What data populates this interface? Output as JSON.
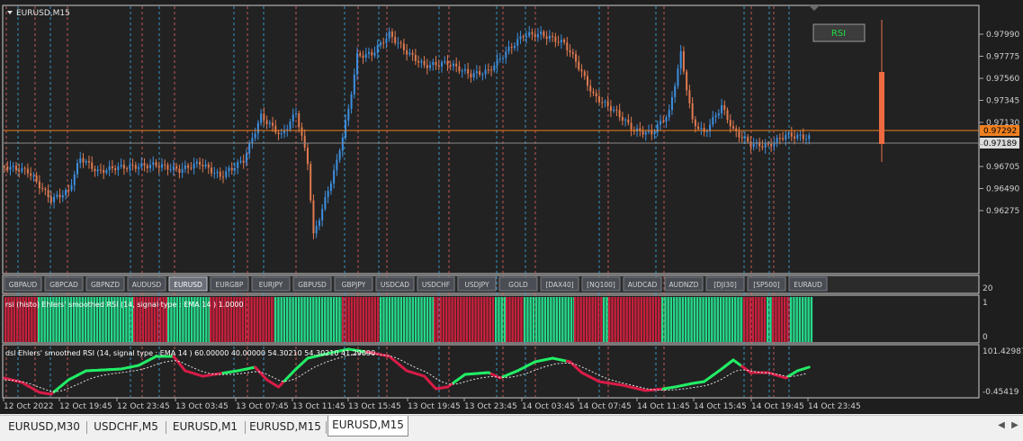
{
  "window": {
    "symbol_title": "EURUSD,M15"
  },
  "price_panel": {
    "price_ticks": [
      "0.97990",
      "0.97775",
      "0.97560",
      "0.97345",
      "0.97130",
      "0.96920",
      "0.96705",
      "0.96490",
      "0.96275"
    ],
    "current_price_label": "0.97292",
    "bid_price_label": "0.97189",
    "rsi_button_label": "RSI"
  },
  "symbol_buttons": [
    "GBPAUD",
    "GBPCAD",
    "GBPNZD",
    "AUDUSD",
    "EURUSD",
    "EURGBP",
    "EURJPY",
    "GBPUSD",
    "GBPJPY",
    "USDCAD",
    "USDCHF",
    "USDJPY",
    "GOLD",
    "[DAX40]",
    "[NQ100]",
    "AUDCAD",
    "AUDNZD",
    "[DJI30]",
    "[SP500]",
    "EURAUD"
  ],
  "active_symbol": "EURUSD",
  "histo_panel": {
    "title": "rsi (histo) Ehlers' smoothed RSI (14, signal type : EMA  14 ) 1.0000",
    "scale_top": "20",
    "scale_1": "1",
    "scale_0": "0"
  },
  "rsi_panel": {
    "title": "dsl Ehlers' smoothed RSI (14, signal type : EMA  14 ) 60.00000 40.00000 54.30210 54.30210 41.29090",
    "scale_top": "101.42987",
    "scale_bottom": "-0.45419"
  },
  "time_labels": [
    "12 Oct 2022",
    "12 Oct 19:45",
    "12 Oct 23:45",
    "13 Oct 03:45",
    "13 Oct 07:45",
    "13 Oct 11:45",
    "13 Oct 15:45",
    "13 Oct 19:45",
    "13 Oct 23:45",
    "14 Oct 03:45",
    "14 Oct 07:45",
    "14 Oct 11:45",
    "14 Oct 15:45",
    "14 Oct 19:45",
    "14 Oct 23:45"
  ],
  "colors": {
    "background": "#222222",
    "bull_candle": "#3d8fe0",
    "bear_candle": "#e07a50",
    "price_line": "#f08020",
    "histo_green": "#26d98a",
    "histo_red": "#c8203c",
    "rsi_green": "#22ee66",
    "rsi_red": "#d81c46"
  },
  "tabs": [
    {
      "label": "EURUSD,M30"
    },
    {
      "label": "USDCHF,M5"
    },
    {
      "label": "EURUSD,M1"
    },
    {
      "label": "EURUSD,M15"
    },
    {
      "label": "EURUSD,M15"
    }
  ],
  "active_tab": 4
}
